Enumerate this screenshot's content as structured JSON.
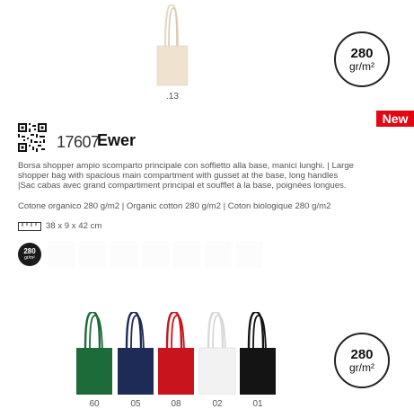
{
  "top_product": {
    "variant_code": ".13",
    "bag_color": "#efe3d0"
  },
  "weight_badge": {
    "value": "280",
    "unit": "gr/m²"
  },
  "new_badge": {
    "label": "New",
    "color": "#e30613"
  },
  "product": {
    "code": "17607",
    "name": "Ewer",
    "description_lines": [
      "Borsa shopper ampio scomparto principale con soffietto alla base, manici lunghi. | Large",
      "shopper bag with spacious main compartment with gusset at the base, long handles",
      "|Sac cabas avec grand compartiment principal et soufflet à la base, poignées longues."
    ],
    "material": "Cotone organico 280 g/m2 | Organic cotton 280 g/m2 | Coton biologique 280 g/m2",
    "dimensions": "38 x 9 x 42 cm",
    "small_badge": {
      "value": "280",
      "unit": "gr/m²"
    }
  },
  "color_variants": [
    {
      "code": "60",
      "color": "#1e6b3a"
    },
    {
      "code": "05",
      "color": "#1f2b57"
    },
    {
      "code": "08",
      "color": "#c8141c"
    },
    {
      "code": "02",
      "color": "#f2f2f2"
    },
    {
      "code": "01",
      "color": "#141414"
    }
  ]
}
